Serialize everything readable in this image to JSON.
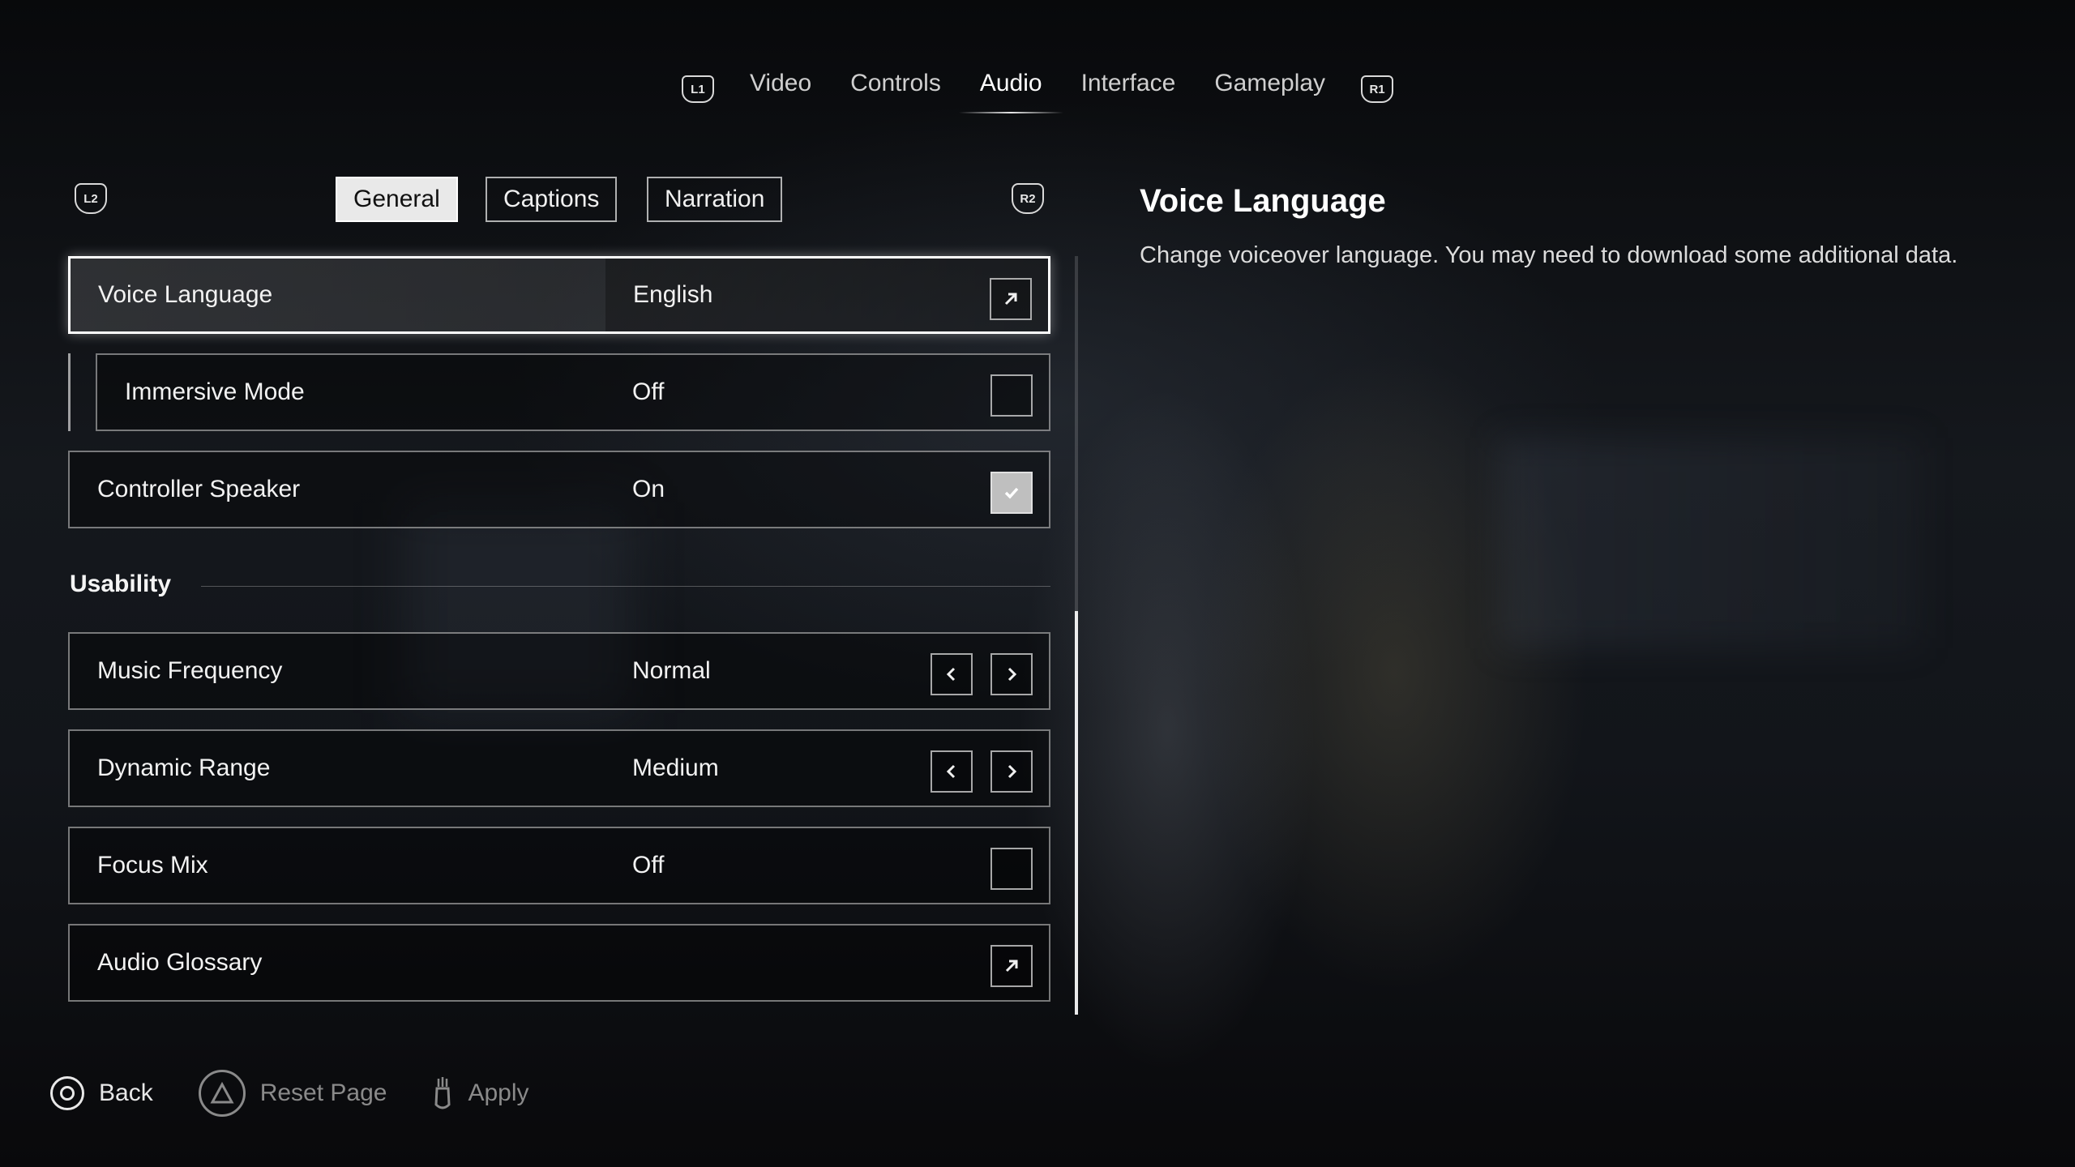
{
  "top_nav": {
    "left_glyph": "L1",
    "right_glyph": "R1",
    "tabs": [
      {
        "label": "Video",
        "active": false
      },
      {
        "label": "Controls",
        "active": false
      },
      {
        "label": "Audio",
        "active": true
      },
      {
        "label": "Interface",
        "active": false
      },
      {
        "label": "Gameplay",
        "active": false
      }
    ]
  },
  "sub_tabs": {
    "left_glyph": "L2",
    "right_glyph": "R2",
    "tabs": [
      {
        "label": "General",
        "active": true
      },
      {
        "label": "Captions",
        "active": false
      },
      {
        "label": "Narration",
        "active": false
      }
    ]
  },
  "settings": [
    {
      "label": "Voice Language",
      "value": "English",
      "control": "external-link-icon",
      "selected": true
    },
    {
      "label": "Immersive Mode",
      "value": "Off",
      "control": "checkbox",
      "checked": false
    },
    {
      "label": "Controller Speaker",
      "value": "On",
      "control": "checkbox",
      "checked": true
    }
  ],
  "usability": {
    "heading": "Usability",
    "items": [
      {
        "label": "Music Frequency",
        "value": "Normal",
        "control": "stepper"
      },
      {
        "label": "Dynamic Range",
        "value": "Medium",
        "control": "stepper"
      },
      {
        "label": "Focus Mix",
        "value": "Off",
        "control": "checkbox",
        "checked": false
      },
      {
        "label": "Audio Glossary",
        "value": "",
        "control": "external-link-icon"
      }
    ]
  },
  "description": {
    "title": "Voice Language",
    "text": "Change voiceover language. You may need to download some additional data."
  },
  "footer": {
    "back": "Back",
    "reset": "Reset Page",
    "apply": "Apply"
  },
  "colors": {
    "accent": "#ffffff",
    "background": "#0b0c0e",
    "muted": "#8a8a8a"
  }
}
